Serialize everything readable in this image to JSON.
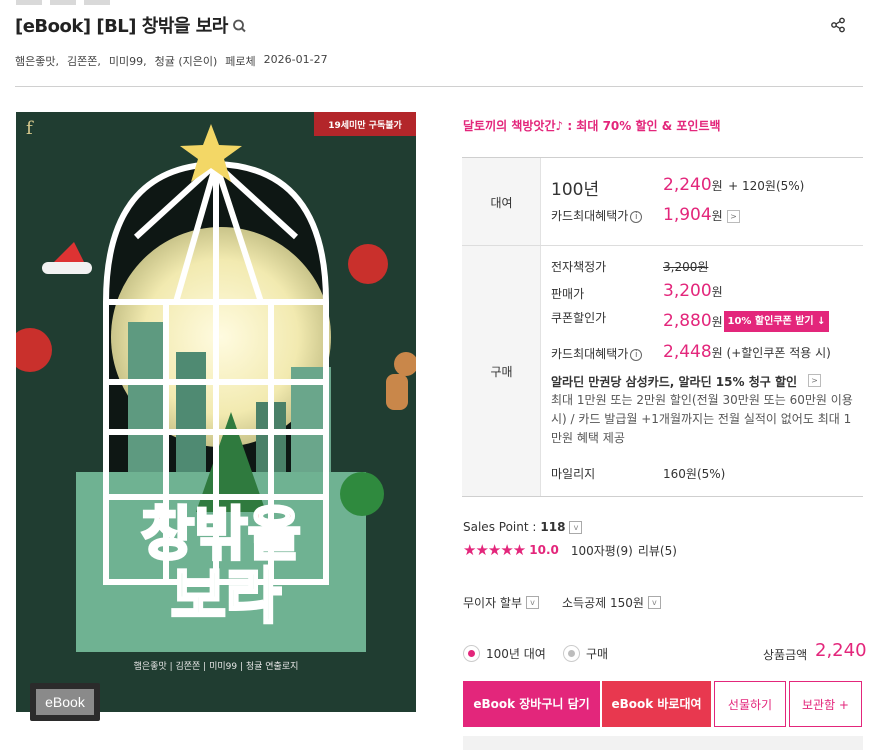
{
  "header": {
    "title": "[eBook] [BL] 창밖을 보라",
    "meta": [
      "햄은좋맛,",
      "김쫀쫀,",
      "미미99,",
      "청귤 (지은이)",
      "페로체",
      "2026-01-27"
    ]
  },
  "cover": {
    "age_badge": "19세미만 구독불가",
    "title_line1": "창밖을",
    "title_line2": "보라",
    "authors": "햄은좋맛 | 김쫀쫀 | 미미99 | 청귤 연출로지",
    "publisher_mark": "f",
    "format_tag": "eBook"
  },
  "promo": "달토끼의 책방앗간♪ : 최대 70% 할인 & 포인트백",
  "rental": {
    "section_label": "대여",
    "period": "100년",
    "price": "2,240",
    "price_unit": "원",
    "points": "+ 120원(5%)",
    "card_label": "카드최대혜택가",
    "card_price": "1,904",
    "card_unit": "원"
  },
  "purchase": {
    "section_label": "구매",
    "list_label": "전자책정가",
    "list_price": "3,200원",
    "sale_label": "판매가",
    "sale_price": "3,200",
    "coupon_label": "쿠폰할인가",
    "coupon_price": "2,880",
    "coupon_button": "10% 할인쿠폰 받기 ↓",
    "card_label": "카드최대혜택가",
    "card_price": "2,448",
    "card_note": "원 (+할인쿠폰 적용 시)",
    "unit": "원",
    "card_promo_title": "알라딘 만권당 삼성카드, 알라딘 15% 청구 할인",
    "card_promo_desc": "최대 1만원 또는 2만원 할인(전월 30만원 또는 60만원 이용 시) / 카드 발급월 +1개월까지는 전월 실적이 없어도 최대 1만원 혜택 제공",
    "mileage_label": "마일리지",
    "mileage_value": "160원(5%)"
  },
  "sales": {
    "label": "Sales Point :",
    "value": "118",
    "stars": "★★★★★",
    "rating": "10.0",
    "reviews_count": "100자평(9)",
    "reviews": "리뷰(5)"
  },
  "options": {
    "installment": "무이자 할부",
    "deduction": "소득공제 150원"
  },
  "order": {
    "radio_rent": "100년 대여",
    "radio_buy": "구매",
    "total_label": "상품금액",
    "total_value": "2,240"
  },
  "buttons": {
    "cart": "eBook 장바구니 담기",
    "rent_now": "eBook 바로대여",
    "gift": "선물하기",
    "save": "보관함 +"
  },
  "colors": {
    "accent": "#e3267b",
    "rent_button": "#e8384f"
  }
}
